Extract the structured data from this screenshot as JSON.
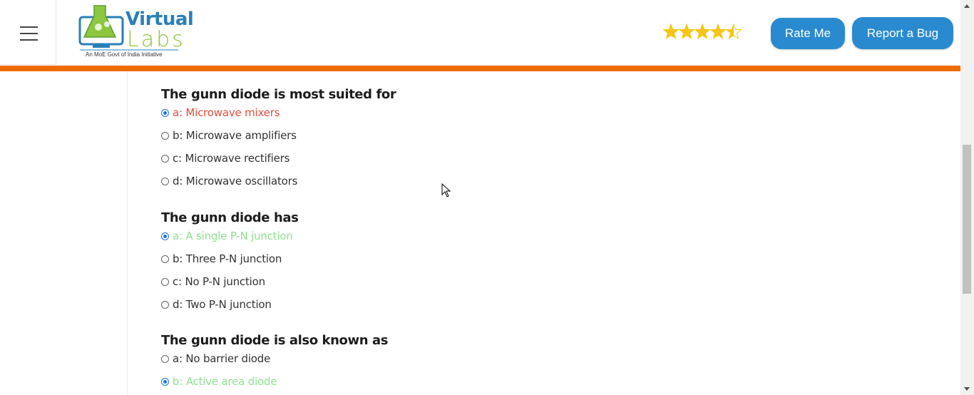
{
  "header": {
    "logo": {
      "title_top": "Virtual",
      "title_bottom": "Labs",
      "subtitle": "An MoE Govt of India Initiative"
    },
    "rating": {
      "value": 4.5,
      "max": 5
    },
    "rate_button": "Rate Me",
    "bug_button": "Report a Bug"
  },
  "colors": {
    "accent_orange": "#ef6c00",
    "button_blue": "#2a8ad0",
    "wrong_answer": "#e74c3c",
    "correct_answer": "#8fe08f"
  },
  "questions": [
    {
      "text": "The gunn diode is most suited for",
      "options": [
        {
          "label": "a: Microwave mixers",
          "checked": true,
          "state": "wrong"
        },
        {
          "label": "b: Microwave amplifiers",
          "checked": false,
          "state": "none"
        },
        {
          "label": "c: Microwave rectifiers",
          "checked": false,
          "state": "none"
        },
        {
          "label": "d: Microwave oscillators",
          "checked": false,
          "state": "none"
        }
      ]
    },
    {
      "text": "The gunn diode has",
      "options": [
        {
          "label": "a: A single P-N junction",
          "checked": true,
          "state": "correct"
        },
        {
          "label": "b: Three P-N junction",
          "checked": false,
          "state": "none"
        },
        {
          "label": "c: No P-N junction",
          "checked": false,
          "state": "none"
        },
        {
          "label": "d: Two P-N junction",
          "checked": false,
          "state": "none"
        }
      ]
    },
    {
      "text": "The gunn diode is also known as",
      "options": [
        {
          "label": "a: No barrier diode",
          "checked": false,
          "state": "none"
        },
        {
          "label": "b: Active area diode",
          "checked": true,
          "state": "correct"
        }
      ]
    }
  ]
}
